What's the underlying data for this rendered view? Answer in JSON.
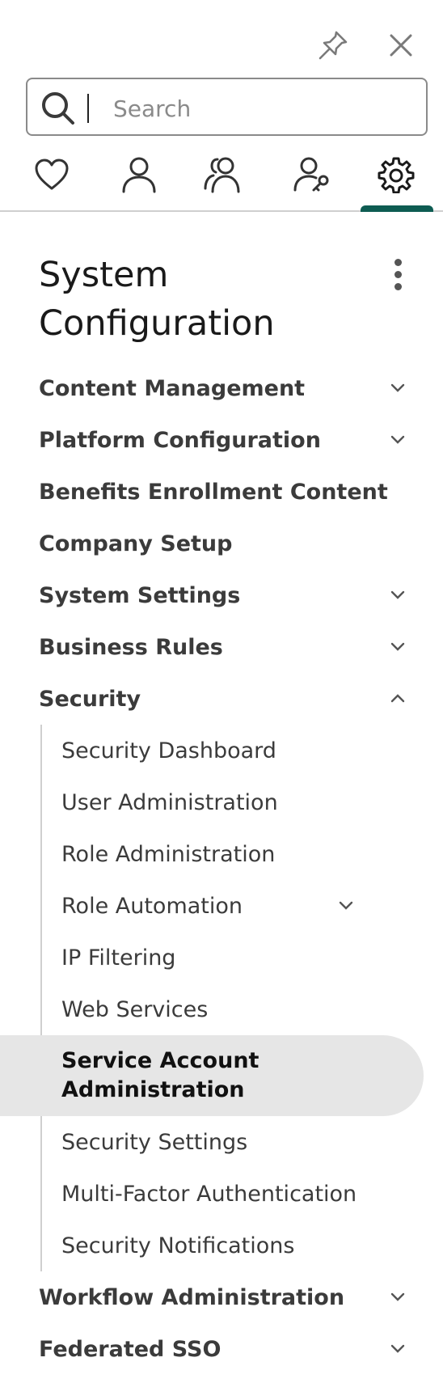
{
  "search": {
    "placeholder": "Search",
    "value": ""
  },
  "topbar": {
    "pin_icon": "pin-icon",
    "close_icon": "close-icon"
  },
  "tabs": [
    {
      "name": "favorites",
      "icon": "heart-icon"
    },
    {
      "name": "user",
      "icon": "person-icon"
    },
    {
      "name": "people",
      "icon": "people-icon"
    },
    {
      "name": "user-settings",
      "icon": "person-key-icon"
    },
    {
      "name": "configuration",
      "icon": "gear-icon",
      "active": true
    }
  ],
  "panel": {
    "title": "System Configuration",
    "menu_icon": "kebab-icon"
  },
  "nav": {
    "items": [
      {
        "label": "Content Management",
        "expandable": true
      },
      {
        "label": "Platform Configuration",
        "expandable": true
      },
      {
        "label": "Benefits Enrollment Content",
        "expandable": false
      },
      {
        "label": "Company Setup",
        "expandable": false
      },
      {
        "label": "System Settings",
        "expandable": true
      },
      {
        "label": "Business Rules",
        "expandable": true
      },
      {
        "label": "Security",
        "expandable": true,
        "expanded": true
      },
      {
        "label": "Workflow Administration",
        "expandable": true
      },
      {
        "label": "Federated SSO",
        "expandable": true
      }
    ],
    "security_children": [
      {
        "label": "Security Dashboard"
      },
      {
        "label": "User Administration"
      },
      {
        "label": "Role Administration"
      },
      {
        "label": "Role Automation",
        "expandable": true
      },
      {
        "label": "IP Filtering"
      },
      {
        "label": "Web Services"
      },
      {
        "label": "Service Account Administration",
        "selected": true
      },
      {
        "label": "Security Settings"
      },
      {
        "label": "Multi-Factor Authentication"
      },
      {
        "label": "Security Notifications"
      }
    ]
  },
  "colors": {
    "accent": "#0e5c52",
    "selected_bg": "#e6e6e6",
    "divider": "#cfcfcf"
  }
}
